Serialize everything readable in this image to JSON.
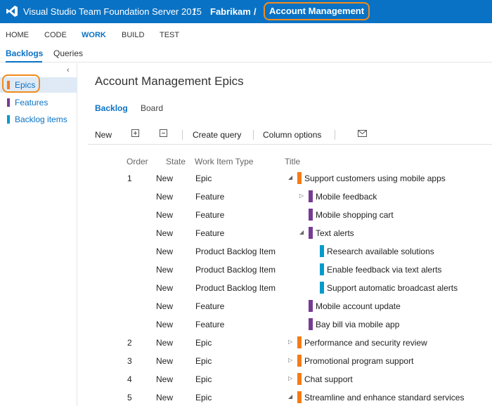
{
  "colors": {
    "brand_blue": "#0a72c4",
    "highlight_orange": "#f28b1b",
    "epic": "#f47b16",
    "feature": "#773b93",
    "backlog_item": "#009ccc"
  },
  "header": {
    "product": "Visual Studio Team Foundation Server 2015",
    "separator": "/",
    "project": "Fabrikam",
    "team": "Account Management"
  },
  "hub_nav": [
    "HOME",
    "CODE",
    "WORK",
    "BUILD",
    "TEST"
  ],
  "hub_nav_active": "WORK",
  "sub_nav": {
    "backlogs": "Backlogs",
    "queries": "Queries"
  },
  "sidebar": {
    "collapse_icon": "chevron-left-icon",
    "items": [
      {
        "label": "Epics",
        "color": "#f47b16",
        "selected": true
      },
      {
        "label": "Features",
        "color": "#773b93",
        "selected": false
      },
      {
        "label": "Backlog items",
        "color": "#009ccc",
        "selected": false
      }
    ]
  },
  "page_title": "Account Management Epics",
  "view_tabs": {
    "backlog": "Backlog",
    "board": "Board"
  },
  "toolbar": {
    "new": "New",
    "expand_icon": "expand-all-icon",
    "collapse_icon": "collapse-all-icon",
    "create_query": "Create query",
    "column_options": "Column options",
    "email_icon": "mail-icon"
  },
  "columns": {
    "order": "Order",
    "state": "State",
    "type": "Work Item Type",
    "title": "Title"
  },
  "rows": [
    {
      "order": "1",
      "state": "New",
      "type": "Epic",
      "title": "Support customers using mobile apps",
      "level": 0,
      "toggle": "expanded"
    },
    {
      "order": "",
      "state": "New",
      "type": "Feature",
      "title": "Mobile feedback",
      "level": 1,
      "toggle": "collapsed"
    },
    {
      "order": "",
      "state": "New",
      "type": "Feature",
      "title": "Mobile shopping cart",
      "level": 1,
      "toggle": "none"
    },
    {
      "order": "",
      "state": "New",
      "type": "Feature",
      "title": "Text alerts",
      "level": 1,
      "toggle": "expanded"
    },
    {
      "order": "",
      "state": "New",
      "type": "Product Backlog Item",
      "title": "Research available solutions",
      "level": 2,
      "toggle": "none"
    },
    {
      "order": "",
      "state": "New",
      "type": "Product Backlog Item",
      "title": "Enable feedback via text alerts",
      "level": 2,
      "toggle": "none"
    },
    {
      "order": "",
      "state": "New",
      "type": "Product Backlog Item",
      "title": "Support automatic broadcast alerts",
      "level": 2,
      "toggle": "none"
    },
    {
      "order": "",
      "state": "New",
      "type": "Feature",
      "title": "Mobile account update",
      "level": 1,
      "toggle": "none"
    },
    {
      "order": "",
      "state": "New",
      "type": "Feature",
      "title": "Bay bill via mobile app",
      "level": 1,
      "toggle": "none"
    },
    {
      "order": "2",
      "state": "New",
      "type": "Epic",
      "title": "Performance and security review",
      "level": 0,
      "toggle": "collapsed"
    },
    {
      "order": "3",
      "state": "New",
      "type": "Epic",
      "title": "Promotional program support",
      "level": 0,
      "toggle": "collapsed"
    },
    {
      "order": "4",
      "state": "New",
      "type": "Epic",
      "title": "Chat support",
      "level": 0,
      "toggle": "collapsed"
    },
    {
      "order": "5",
      "state": "New",
      "type": "Epic",
      "title": "Streamline and enhance standard services",
      "level": 0,
      "toggle": "expanded"
    }
  ]
}
